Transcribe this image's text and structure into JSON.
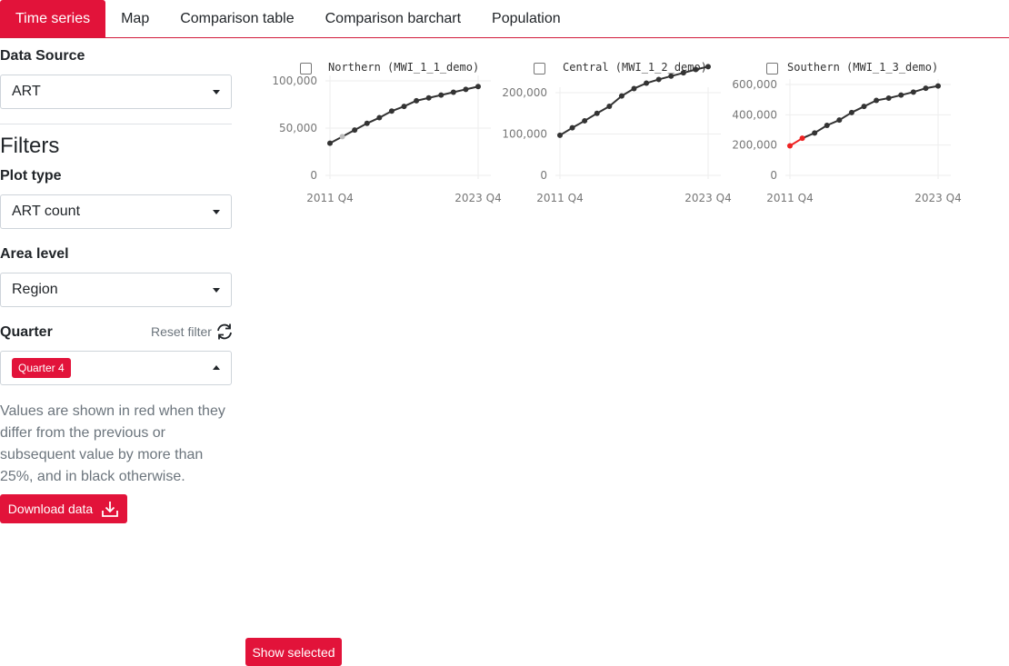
{
  "tabs": [
    "Time series",
    "Map",
    "Comparison table",
    "Comparison barchart",
    "Population"
  ],
  "sidebar": {
    "data_source_label": "Data Source",
    "data_source_value": "ART",
    "filters_heading": "Filters",
    "plot_type_label": "Plot type",
    "plot_type_value": "ART count",
    "area_level_label": "Area level",
    "area_level_value": "Region",
    "quarter_label": "Quarter",
    "reset_filter": "Reset filter",
    "quarter_chip": "Quarter 4",
    "note": "Values are shown in red when they differ from the previous or subsequent value by more than 25%, and in black otherwise.",
    "download_button": "Download data"
  },
  "show_selected_button": "Show selected",
  "colors": {
    "accent": "#e2133a",
    "line": "#333333",
    "flag": "#ee2222",
    "grid": "#eeeeee"
  },
  "icons": {
    "refresh": "refresh-icon",
    "download": "download-icon",
    "dropdown": "caret-down-icon"
  },
  "chart_data": [
    {
      "type": "line",
      "title": "Northern (MWI_1_1_demo)",
      "x_ticks": [
        "2011 Q4",
        "2023 Q4"
      ],
      "x": [
        "2011 Q4",
        "2012 Q4",
        "2013 Q4",
        "2014 Q4",
        "2015 Q4",
        "2016 Q4",
        "2017 Q4",
        "2018 Q4",
        "2019 Q4",
        "2020 Q4",
        "2021 Q4",
        "2022 Q4",
        "2023 Q4"
      ],
      "y_ticks": [
        "0",
        "50,000",
        "100,000"
      ],
      "ylim": [
        0,
        100000
      ],
      "values": [
        34000,
        41000,
        48000,
        55000,
        61000,
        68000,
        73000,
        79000,
        82000,
        85000,
        88000,
        91000,
        94000
      ],
      "point_colors": [
        "#333333",
        "#bbbbbb",
        "#333333",
        "#333333",
        "#333333",
        "#333333",
        "#333333",
        "#333333",
        "#333333",
        "#333333",
        "#333333",
        "#333333",
        "#333333"
      ]
    },
    {
      "type": "line",
      "title": "Central (MWI_1_2_demo)",
      "x_ticks": [
        "2011 Q4",
        "2023 Q4"
      ],
      "x": [
        "2011 Q4",
        "2012 Q4",
        "2013 Q4",
        "2014 Q4",
        "2015 Q4",
        "2016 Q4",
        "2017 Q4",
        "2018 Q4",
        "2019 Q4",
        "2020 Q4",
        "2021 Q4",
        "2022 Q4",
        "2023 Q4"
      ],
      "y_ticks": [
        "0",
        "100,000",
        "200,000"
      ],
      "ylim": [
        0,
        200000
      ],
      "values": [
        97000,
        115000,
        132000,
        150000,
        167000,
        192000,
        210000,
        223000,
        232000,
        240000,
        248000,
        256000,
        263000
      ],
      "point_colors": [
        "#333333",
        "#333333",
        "#333333",
        "#333333",
        "#333333",
        "#333333",
        "#333333",
        "#333333",
        "#333333",
        "#333333",
        "#333333",
        "#333333",
        "#333333"
      ]
    },
    {
      "type": "line",
      "title": "Southern (MWI_1_3_demo)",
      "x_ticks": [
        "2011 Q4",
        "2023 Q4"
      ],
      "x": [
        "2011 Q4",
        "2012 Q4",
        "2013 Q4",
        "2014 Q4",
        "2015 Q4",
        "2016 Q4",
        "2017 Q4",
        "2018 Q4",
        "2019 Q4",
        "2020 Q4",
        "2021 Q4",
        "2022 Q4",
        "2023 Q4"
      ],
      "y_ticks": [
        "0",
        "200,000",
        "400,000",
        "600,000"
      ],
      "ylim": [
        0,
        600000
      ],
      "values": [
        195000,
        245000,
        280000,
        330000,
        365000,
        415000,
        455000,
        495000,
        510000,
        530000,
        550000,
        575000,
        590000
      ],
      "point_colors": [
        "#ee2222",
        "#ee2222",
        "#333333",
        "#333333",
        "#333333",
        "#333333",
        "#333333",
        "#333333",
        "#333333",
        "#333333",
        "#333333",
        "#333333",
        "#333333"
      ]
    }
  ]
}
